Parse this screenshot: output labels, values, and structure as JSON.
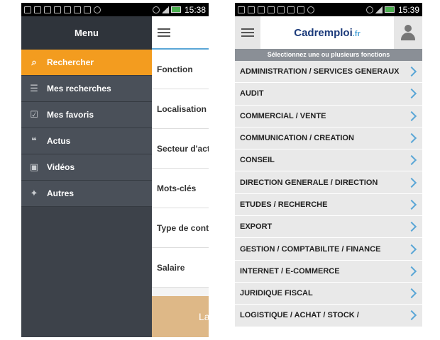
{
  "left": {
    "status": {
      "time": "15:38"
    },
    "drawer": {
      "title": "Menu",
      "items": [
        {
          "label": "Rechercher",
          "icon": "search-icon",
          "glyph": "⌕",
          "active": true
        },
        {
          "label": "Mes recherches",
          "icon": "list-icon",
          "glyph": "☰",
          "active": false
        },
        {
          "label": "Mes favoris",
          "icon": "checkbox-icon",
          "glyph": "☑",
          "active": false
        },
        {
          "label": "Actus",
          "icon": "quote-icon",
          "glyph": "❝",
          "active": false
        },
        {
          "label": "Vidéos",
          "icon": "clapperboard-icon",
          "glyph": "▣",
          "active": false
        },
        {
          "label": "Autres",
          "icon": "star-box-icon",
          "glyph": "✦",
          "active": false
        }
      ]
    },
    "peek": {
      "rows": [
        "Fonction",
        "Localisation",
        "Secteur d'acti",
        "Mots-clés",
        "Type de contra",
        "Salaire"
      ],
      "bottom_text": "La"
    }
  },
  "right": {
    "status": {
      "time": "15:39"
    },
    "logo": {
      "main": "Cadremploi",
      "suffix": ".fr"
    },
    "subheader": "Sélectionnez une ou plusieurs fonctions",
    "functions": [
      "ADMINISTRATION / SERVICES GENERAUX",
      "AUDIT",
      "COMMERCIAL / VENTE",
      "COMMUNICATION / CREATION",
      "CONSEIL",
      "DIRECTION GENERALE / DIRECTION",
      "ETUDES / RECHERCHE",
      "EXPORT",
      "GESTION / COMPTABILITE / FINANCE",
      "INTERNET / E-COMMERCE",
      "JURIDIQUE FISCAL",
      "LOGISTIQUE / ACHAT / STOCK /"
    ]
  },
  "colors": {
    "accent": "#f39c1f",
    "drawer": "#3d424a",
    "chevron": "#5aa6d6"
  }
}
